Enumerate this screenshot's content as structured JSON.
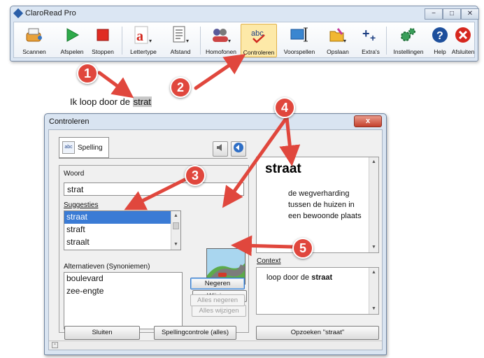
{
  "toolbar_window": {
    "title": "ClaroRead Pro",
    "buttons": [
      {
        "label": "Scannen",
        "icon": "scanner-icon"
      },
      {
        "label": "Afspelen",
        "icon": "play-icon"
      },
      {
        "label": "Stoppen",
        "icon": "stop-icon"
      },
      {
        "label": "Lettertype",
        "icon": "font-icon"
      },
      {
        "label": "Afstand",
        "icon": "spacing-icon"
      },
      {
        "label": "Homofonen",
        "icon": "homophones-icon"
      },
      {
        "label": "Controleren",
        "icon": "spellcheck-icon"
      },
      {
        "label": "Voorspellen",
        "icon": "prediction-icon"
      },
      {
        "label": "Opslaan",
        "icon": "save-icon"
      },
      {
        "label": "Extra's",
        "icon": "extras-icon"
      },
      {
        "label": "Instellingen",
        "icon": "settings-icon"
      },
      {
        "label": "Help",
        "icon": "help-icon"
      },
      {
        "label": "Afsluiten",
        "icon": "exit-icon"
      }
    ],
    "active": "Controleren"
  },
  "document": {
    "text_before": "Ik loop door de ",
    "highlighted_word": "strat"
  },
  "badges": [
    "1",
    "2",
    "3",
    "4",
    "5"
  ],
  "dialog": {
    "title": "Controleren",
    "close_label": "x",
    "tab_label": "Spelling",
    "tab_icon_text": "abc",
    "woord_label": "Woord",
    "woord_value": "strat",
    "suggesties_label": "Suggesties",
    "suggestions": [
      "straat",
      "straft",
      "straalt"
    ],
    "selected_suggestion": "straat",
    "alternatieven_label": "Alternatieven (Synoniemen)",
    "alternatives": [
      "boulevard",
      "zee-engte"
    ],
    "buttons": {
      "wijzigen": "Wijzigen",
      "alles_wijzigen": "Alles wijzigen",
      "negeren": "Negeren",
      "alles_negeren": "Alles negeren"
    },
    "definition": {
      "word": "straat",
      "text": "de wegverharding tussen de huizen in een bewoonde plaats"
    },
    "context_label": "Context",
    "context": {
      "before": "loop door de ",
      "word": "straat"
    },
    "bottom_buttons": {
      "sluiten": "Sluiten",
      "spellingcontrole": "Spellingcontrole (alles)",
      "opzoeken": "Opzoeken \"straat\""
    }
  },
  "colors": {
    "badge": "#e0473d",
    "arrow": "#e0473d",
    "selection": "#3a7bd5",
    "window_frame": "#d9e4f1"
  }
}
